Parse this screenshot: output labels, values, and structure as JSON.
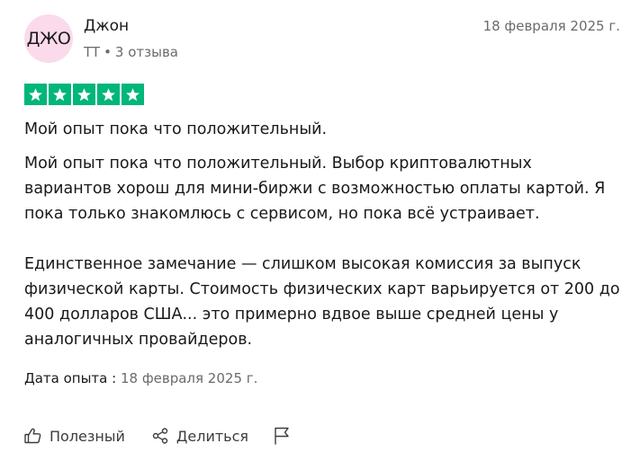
{
  "author": {
    "initials": "ДЖО",
    "name": "Джон",
    "country": "TT",
    "reviews_count": "3 отзыва",
    "avatar_color": "#fbdaec"
  },
  "review": {
    "date": "18 февраля 2025 г.",
    "rating": 5,
    "star_color": "#00b67a",
    "title": "Мой опыт пока что положительный.",
    "paragraph_1": "Мой опыт пока что положительный. Выбор криптовалютных вариантов хорош для мини-биржи с возможностью оплаты картой. Я пока только знакомлюсь с сервисом, но пока всё устраивает.",
    "paragraph_2": "Единственное замечание — слишком высокая комиссия за выпуск физической карты. Стоимость физических карт варьируется от 200 до 400 долларов США... это примерно вдвое выше средней цены у аналогичных провайдеров.",
    "experience_label": "Дата опыта :",
    "experience_date": "18 февраля 2025 г."
  },
  "actions": {
    "helpful": {
      "label": "Полезный",
      "icon": "thumbs-up-icon"
    },
    "share": {
      "label": "Делиться",
      "icon": "share-icon"
    },
    "report": {
      "icon": "flag-icon"
    }
  }
}
